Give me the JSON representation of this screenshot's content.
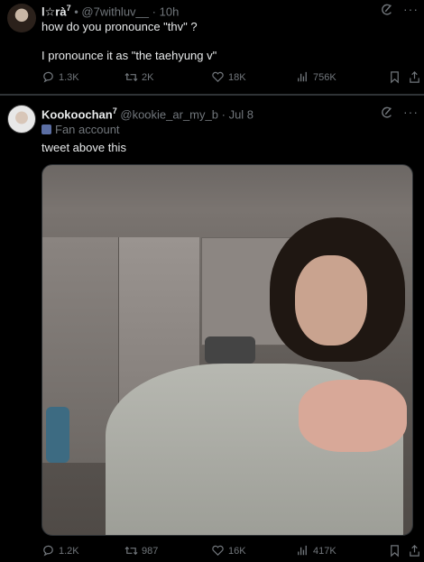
{
  "tweet1": {
    "name": "l☆rà",
    "name_sup": "7",
    "handle": "@7withluv__",
    "time": "10h",
    "line1": "how do you pronounce \"thv\" ?",
    "line2": "I pronounce it as \"the taehyung v\"",
    "stats": {
      "replies": "1.3K",
      "retweets": "2K",
      "likes": "18K",
      "views": "756K"
    }
  },
  "tweet2": {
    "name": "Kookoochan",
    "name_sup": "7",
    "handle": "@kookie_ar_my_b",
    "time": "Jul 8",
    "label": "Fan account",
    "text": "tweet above this",
    "stats": {
      "replies": "1.2K",
      "retweets": "987",
      "likes": "16K",
      "views": "417K"
    }
  },
  "icons": {
    "reply": "reply-icon",
    "retweet": "retweet-icon",
    "like": "heart-icon",
    "views": "views-icon",
    "bookmark": "bookmark-icon",
    "share": "share-icon",
    "grok": "grok-icon",
    "more": "more-icon"
  },
  "colors": {
    "background": "#000000",
    "text": "#e7e9ea",
    "muted": "#71767b",
    "divider": "#2f3336"
  }
}
